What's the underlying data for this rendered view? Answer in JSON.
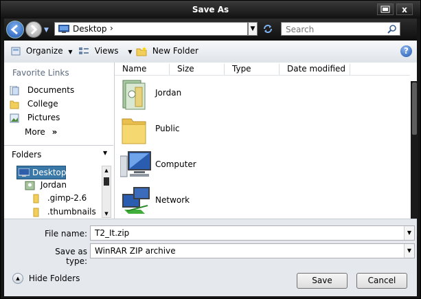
{
  "window": {
    "title": "Save As",
    "close_label": "x"
  },
  "address": {
    "location": "Desktop",
    "chevron": "›",
    "search_placeholder": "Search"
  },
  "toolbar": {
    "organize": "Organize",
    "views": "Views",
    "new_folder": "New Folder"
  },
  "left_pane": {
    "favorites_heading": "Favorite Links",
    "favorites": [
      {
        "label": "Documents",
        "icon": "documents-icon"
      },
      {
        "label": "College",
        "icon": "folder-icon"
      },
      {
        "label": "Pictures",
        "icon": "pictures-icon"
      }
    ],
    "more": "More",
    "more_arrow": "»",
    "folders_heading": "Folders",
    "tree": [
      "Desktop",
      "Jordan",
      ".gimp-2.6",
      ".thumbnails"
    ]
  },
  "columns": [
    "Name",
    "Size",
    "Type",
    "Date modified"
  ],
  "items": [
    {
      "label": "Jordan",
      "icon": "user-folder-icon"
    },
    {
      "label": "Public",
      "icon": "folder-icon"
    },
    {
      "label": "Computer",
      "icon": "computer-icon"
    },
    {
      "label": "Network",
      "icon": "network-icon"
    }
  ],
  "form": {
    "file_name_label": "File name:",
    "file_name_value": "T2_It.zip",
    "save_type_label": "Save as type:",
    "save_type_value": "WinRAR ZIP archive"
  },
  "footer": {
    "hide_folders": "Hide Folders",
    "save": "Save",
    "cancel": "Cancel"
  },
  "colors": {
    "title_bar": "#1c1c1c",
    "selection": "#3a78a8",
    "accent": "#2a63b8"
  }
}
